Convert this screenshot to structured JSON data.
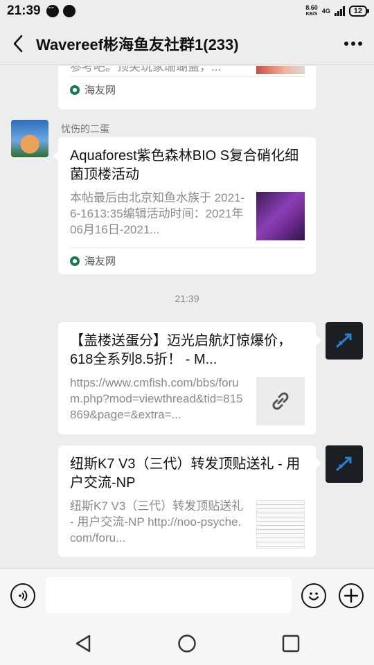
{
  "status_bar": {
    "time": "21:39",
    "net_speed_value": "8.60",
    "net_speed_unit": "KB/S",
    "signal": "4G",
    "battery": "12"
  },
  "header": {
    "title": "Wavereef彬海鱼友社群1(233)"
  },
  "messages": [
    {
      "title": "参考吧。顶尖玩家珊瑚盖，...",
      "source": "海友网"
    },
    {
      "sender": "忧伤的二蛋",
      "title": "Aquaforest紫色森林BIO S复合硝化细菌顶楼活动",
      "description": "本帖最后由北京知鱼水族于 2021-6-1613:35编辑活动时间：2021年06月16日-2021...",
      "source": "海友网"
    },
    {
      "timestamp": "21:39"
    },
    {
      "title": "【盖楼送蛋分】迈光启航灯惊爆价，618全系列8.5折！ - M...",
      "description": "https://www.cmfish.com/bbs/forum.php?mod=viewthread&tid=815869&page=&extra=..."
    },
    {
      "title": "纽斯K7 V3（三代）转发顶贴送礼 - 用户交流-NP",
      "description": "纽斯K7 V3（三代）转发顶贴送礼 - 用户交流-NP http://noo-psyche.com/foru..."
    }
  ],
  "icons": {
    "back": "chevron-left-icon",
    "more": "more-icon",
    "source": "haiyou-logo-icon",
    "link": "link-icon",
    "voice": "voice-icon",
    "emoji": "emoji-icon",
    "plus": "plus-icon"
  },
  "colors": {
    "background": "#ededed",
    "bubble": "#ffffff",
    "meta_text": "#8a8a8a",
    "source_green": "#1e7b4f"
  }
}
